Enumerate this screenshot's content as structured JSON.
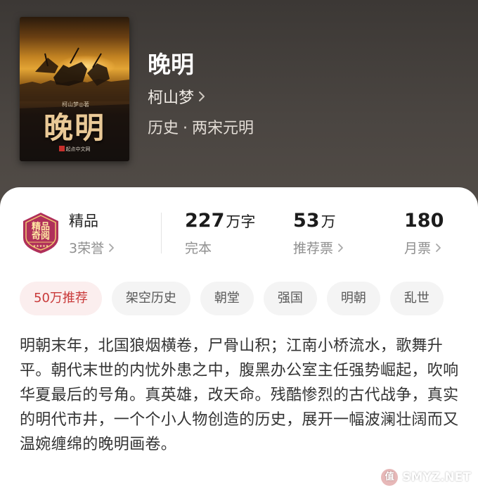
{
  "book": {
    "cover": {
      "title": "晚明",
      "author_line": "柯山梦◎著",
      "publisher": "起点中文网"
    },
    "title": "晚明",
    "author": "柯山梦",
    "category": {
      "main": "历史",
      "separator": "·",
      "sub": "两宋元明"
    }
  },
  "badge": {
    "line1": "精品",
    "line2": "奇阅"
  },
  "stats": {
    "quality": {
      "label": "精品",
      "sub": "3荣誉"
    },
    "words": {
      "value": "227",
      "unit": "万字",
      "sub": "完本"
    },
    "recommend": {
      "value": "53",
      "unit": "万",
      "sub": "推荐票"
    },
    "monthly": {
      "value": "180",
      "sub": "月票"
    }
  },
  "tags": [
    "50万推荐",
    "架空历史",
    "朝堂",
    "强国",
    "明朝",
    "乱世"
  ],
  "description": "明朝末年，北国狼烟横卷，尸骨山积；江南小桥流水，歌舞升平。朝代末世的内忧外患之中，腹黑办公室主任强势崛起，吹响华夏最后的号角。真英雄，改天命。残酷惨烈的古代战争，真实的明代市井，一个个小人物创造的历史，展开一幅波澜壮阔而又温婉缠绵的晚明画卷。",
  "watermark": {
    "icon_text": "值",
    "text": "SMYZ.NET"
  },
  "colors": {
    "hero_bg": "#3c3835",
    "card_bg": "#ffffff",
    "hot_tag_text": "#c93a3a",
    "hot_tag_bg": "#fbeeee",
    "tag_bg": "#f4f4f4",
    "badge_bg": "#b0305a"
  }
}
